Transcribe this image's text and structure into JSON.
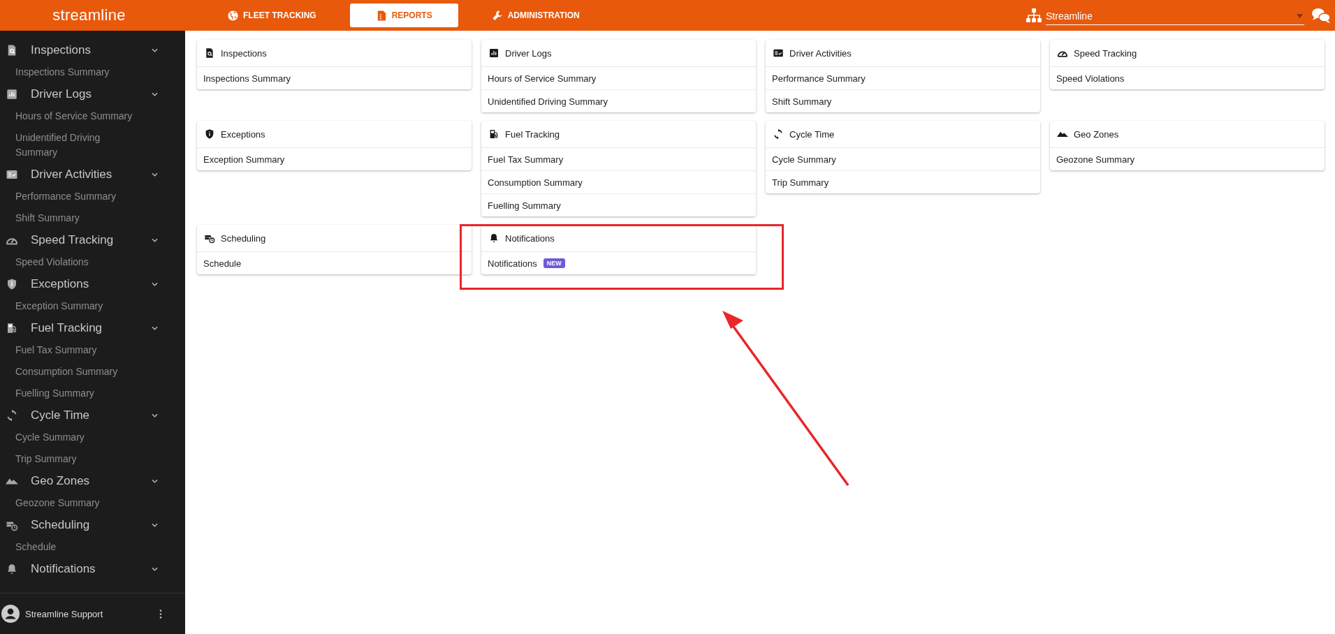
{
  "header": {
    "logo": "streamline",
    "tabs": [
      {
        "label": "FLEET TRACKING",
        "selected": false
      },
      {
        "label": "REPORTS",
        "selected": true
      },
      {
        "label": "ADMINISTRATION",
        "selected": false
      }
    ],
    "organization": "Streamline"
  },
  "sidebar": {
    "groups": [
      {
        "label": "Inspections",
        "expanded": true,
        "children": [
          "Inspections Summary"
        ]
      },
      {
        "label": "Driver Logs",
        "expanded": true,
        "children": [
          "Hours of Service Summary",
          "Unidentified Driving Summary"
        ]
      },
      {
        "label": "Driver Activities",
        "expanded": true,
        "children": [
          "Performance Summary",
          "Shift Summary"
        ]
      },
      {
        "label": "Speed Tracking",
        "expanded": true,
        "children": [
          "Speed Violations"
        ]
      },
      {
        "label": "Exceptions",
        "expanded": true,
        "children": [
          "Exception Summary"
        ]
      },
      {
        "label": "Fuel Tracking",
        "expanded": true,
        "children": [
          "Fuel Tax Summary",
          "Consumption Summary",
          "Fuelling Summary"
        ]
      },
      {
        "label": "Cycle Time",
        "expanded": true,
        "children": [
          "Cycle Summary",
          "Trip Summary"
        ]
      },
      {
        "label": "Geo Zones",
        "expanded": true,
        "children": [
          "Geozone Summary"
        ]
      },
      {
        "label": "Scheduling",
        "expanded": true,
        "children": [
          "Schedule"
        ]
      },
      {
        "label": "Notifications",
        "expanded": true
      }
    ],
    "user": "Streamline Support"
  },
  "cards": [
    {
      "title": "Inspections",
      "items": [
        {
          "label": "Inspections Summary"
        }
      ]
    },
    {
      "title": "Driver Logs",
      "items": [
        {
          "label": "Hours of Service Summary"
        },
        {
          "label": "Unidentified Driving Summary"
        }
      ]
    },
    {
      "title": "Driver Activities",
      "items": [
        {
          "label": "Performance Summary"
        },
        {
          "label": "Shift Summary"
        }
      ]
    },
    {
      "title": "Speed Tracking",
      "items": [
        {
          "label": "Speed Violations"
        }
      ]
    },
    {
      "title": "Exceptions",
      "items": [
        {
          "label": "Exception Summary"
        }
      ]
    },
    {
      "title": "Fuel Tracking",
      "items": [
        {
          "label": "Fuel Tax Summary"
        },
        {
          "label": "Consumption Summary"
        },
        {
          "label": "Fuelling Summary"
        }
      ]
    },
    {
      "title": "Cycle Time",
      "items": [
        {
          "label": "Cycle Summary"
        },
        {
          "label": "Trip Summary"
        }
      ]
    },
    {
      "title": "Geo Zones",
      "items": [
        {
          "label": "Geozone Summary"
        }
      ]
    },
    {
      "title": "Scheduling",
      "items": [
        {
          "label": "Schedule"
        }
      ]
    },
    {
      "title": "Notifications",
      "items": [
        {
          "label": "Notifications",
          "badge": "NEW"
        }
      ]
    }
  ]
}
